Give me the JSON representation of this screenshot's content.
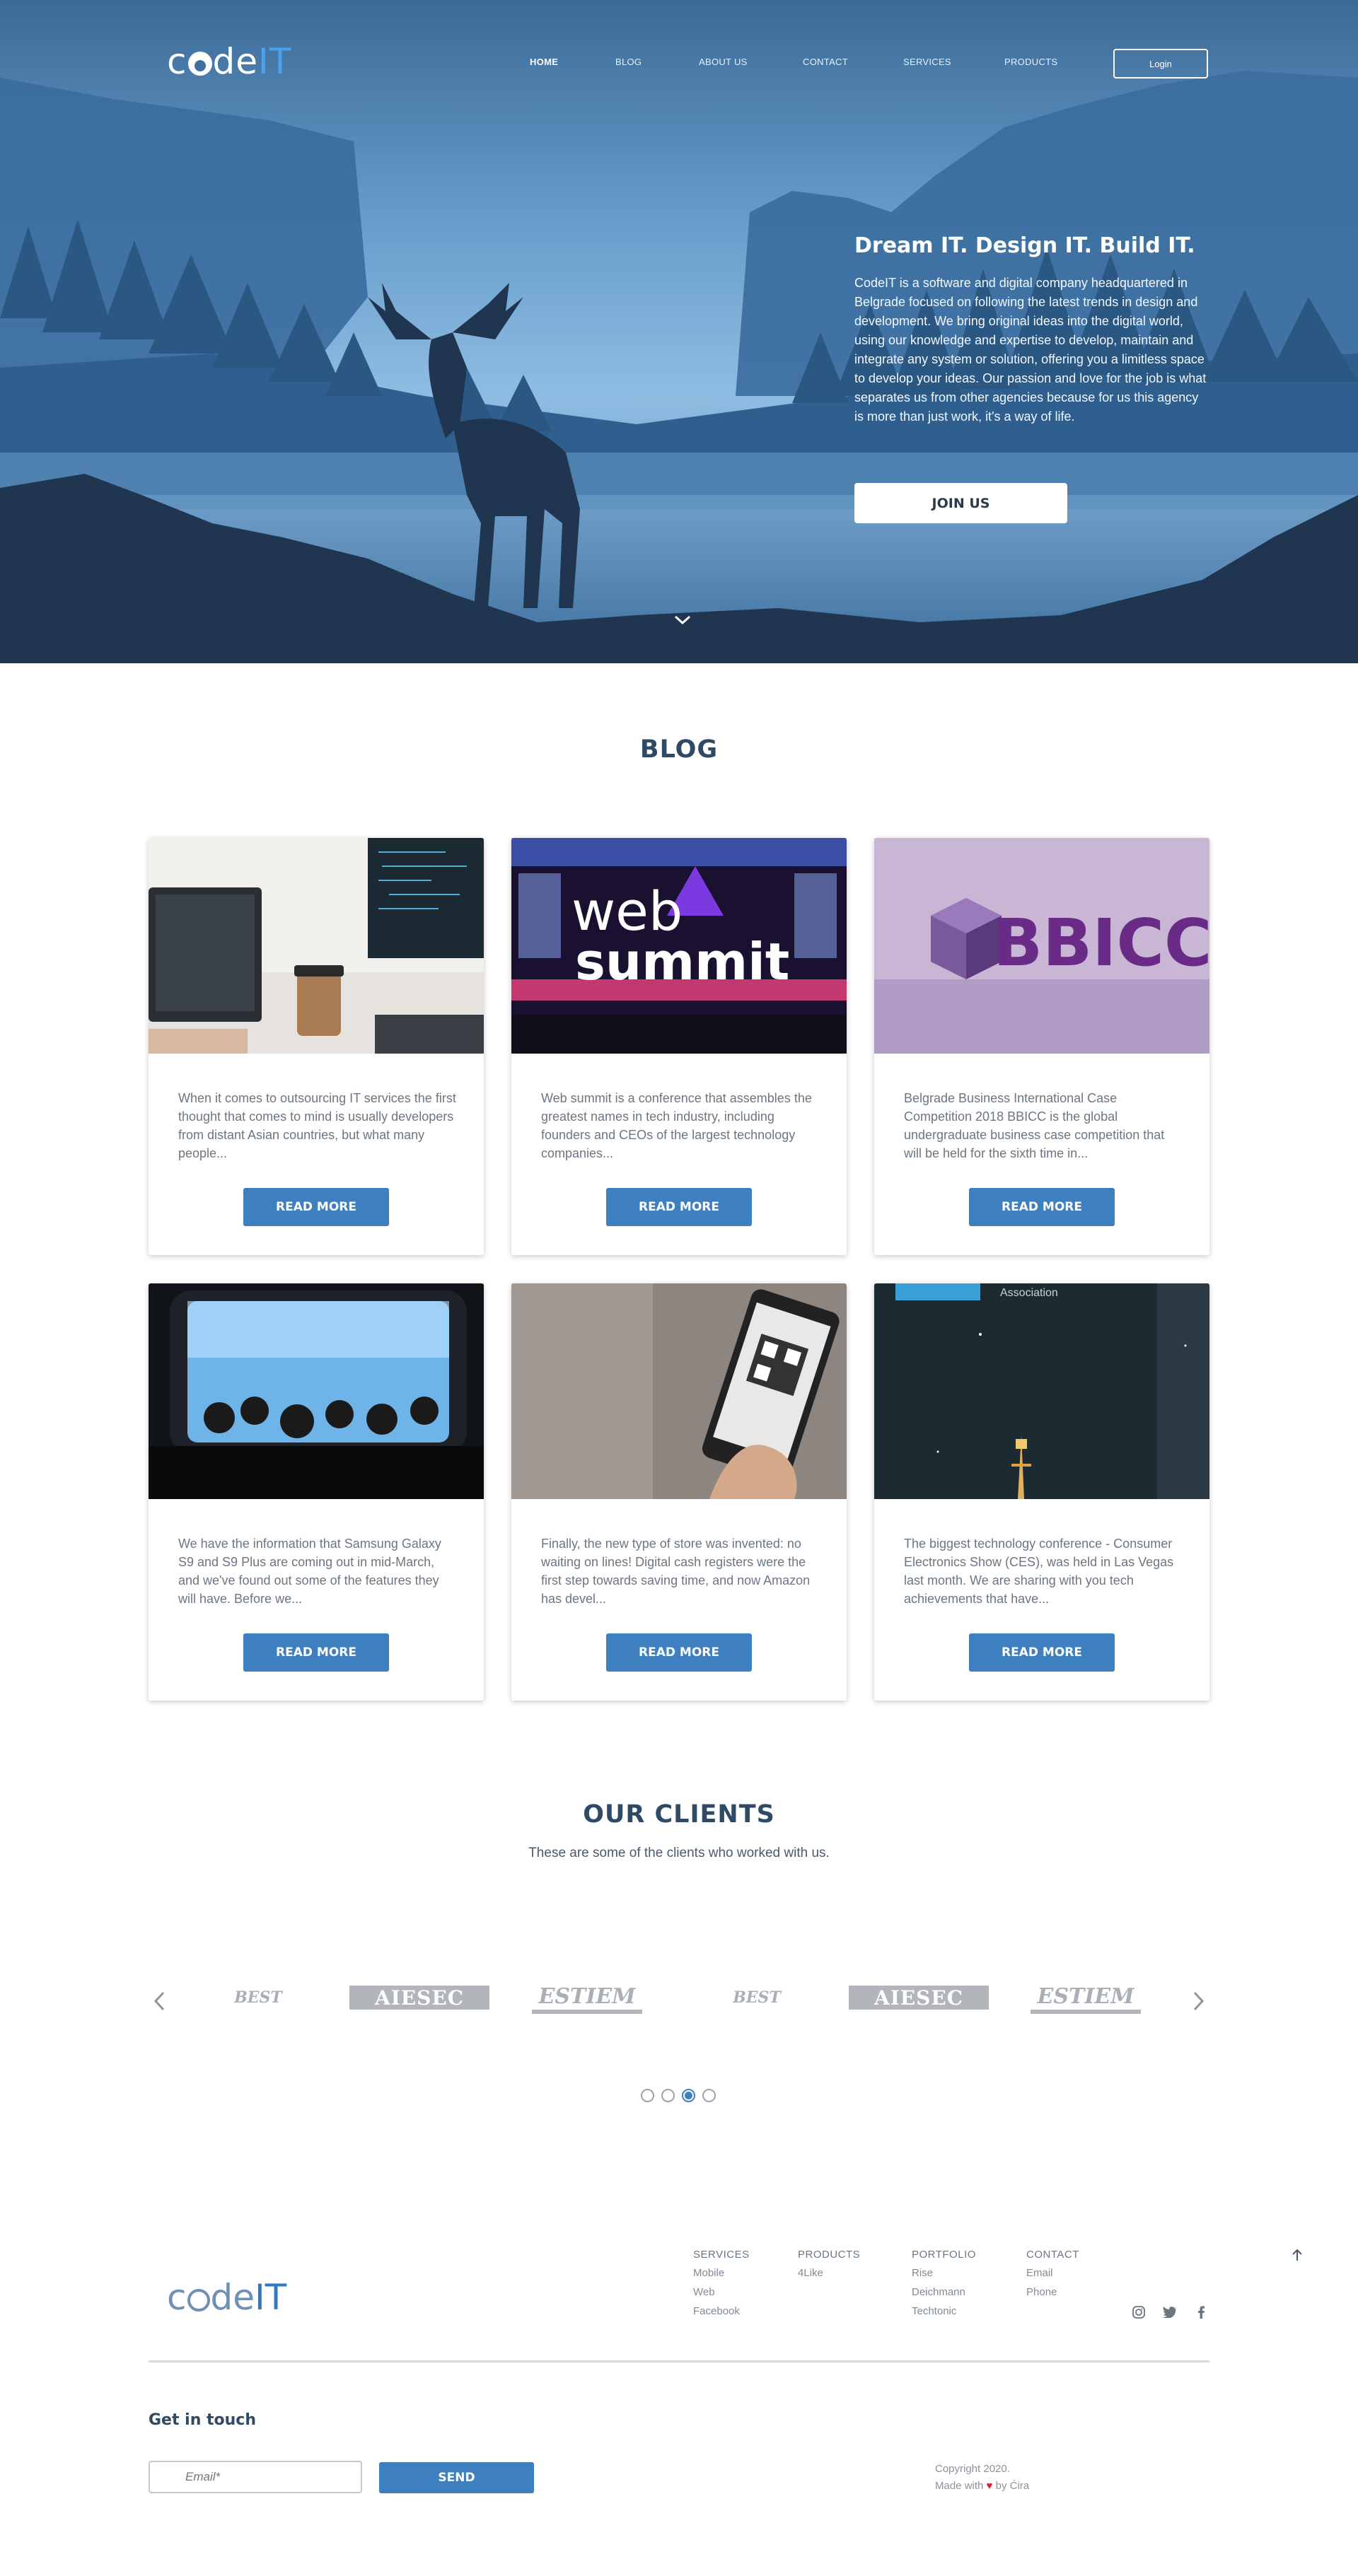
{
  "header": {
    "logo": {
      "code": "c",
      "de": "de",
      "it": "IT"
    },
    "nav": [
      "HOME",
      "BLOG",
      "ABOUT US",
      "CONTACT",
      "SERVICES",
      "PRODUCTS"
    ],
    "login_label": "Login"
  },
  "hero": {
    "title": "Dream IT. Design IT. Build IT.",
    "description": "CodeIT is a software and digital company headquartered in Belgrade focused on following the latest trends in design and development. We bring original ideas into the digital world, using our knowledge and expertise to develop, maintain and integrate any system or solution, offering you a limitless space to develop your ideas. Our passion and love for the job is what separates us from other agencies because for us this agency is more than just work, it's a way of life.",
    "cta_label": "JOIN US"
  },
  "blog": {
    "title": "BLOG",
    "read_more": "READ MORE",
    "posts": [
      {
        "image": "laptop-coffee-desk",
        "excerpt": "When it comes to outsourcing IT services the first thought that comes to mind is usually developers from distant Asian countries, but what many people..."
      },
      {
        "image": "web-summit-stage",
        "image_text": [
          "web",
          "summit"
        ],
        "excerpt": "Web summit is a conference that assembles the greatest names in tech industry, including founders and CEOs of the largest technology companies..."
      },
      {
        "image": "bbicc-logo",
        "image_text": [
          "BBICC"
        ],
        "excerpt": "Belgrade Business International Case Competition 2018 BBICC is the global undergraduate business case competition that will be held for the sixth time in..."
      },
      {
        "image": "phone-concert",
        "excerpt": "We have the information that Samsung Galaxy S9 and S9 Plus are coming out in mid-March, and we've found out some of the features they will have. Before we..."
      },
      {
        "image": "phone-qr-code",
        "excerpt": "Finally, the new type of store was invented: no waiting on lines! Digital cash registers were the first step towards saving time, and now Amazon has devel..."
      },
      {
        "image": "ces-las-vegas-night",
        "image_text": [
          "Association"
        ],
        "excerpt": "The biggest technology conference - Consumer Electronics Show (CES), was held in Las Vegas last month. We are sharing with you tech achievements that have..."
      }
    ]
  },
  "clients": {
    "title": "OUR CLIENTS",
    "subtitle": "These are some of the clients who worked with us.",
    "logos": [
      "BEST",
      "AIESEC",
      "ESTIEM",
      "BEST",
      "AIESEC",
      "ESTIEM"
    ],
    "slides": 4,
    "active_slide": 3
  },
  "footer": {
    "logo": {
      "code": "c",
      "de": "de",
      "it": "IT"
    },
    "columns": [
      {
        "heading": "SERVICES",
        "items": [
          "Mobile",
          "Web",
          "Facebook"
        ]
      },
      {
        "heading": "PRODUCTS",
        "items": [
          "4Like"
        ]
      },
      {
        "heading": "PORTFOLIO",
        "items": [
          "Rise",
          "Deichmann",
          "Techtonic"
        ]
      },
      {
        "heading": "CONTACT",
        "items": [
          "Email",
          "Phone"
        ]
      }
    ],
    "social": [
      "instagram-icon",
      "twitter-icon",
      "facebook-icon"
    ],
    "get_in_touch": "Get in touch",
    "email_placeholder": "Email*",
    "send_label": "SEND",
    "copyright": "Copyright 2020.",
    "made_with": "Made with",
    "made_by": "by Ćira"
  },
  "colors": {
    "accent": "#3d7fbf",
    "logo_it": "#4aa3ea",
    "heading": "#2f4a64"
  }
}
